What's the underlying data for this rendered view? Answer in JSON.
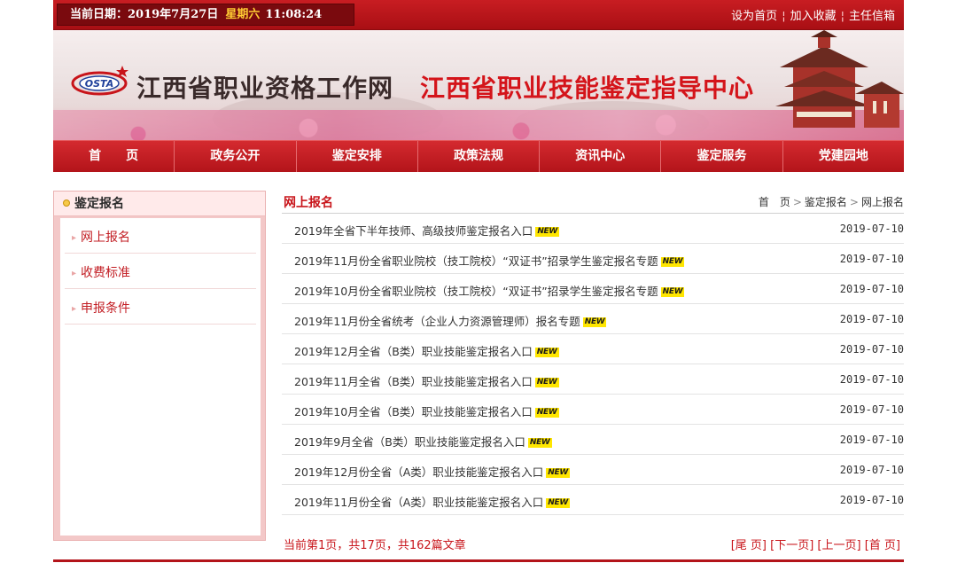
{
  "topbar": {
    "date_label": "当前日期：2019年7月27日",
    "weekday": "星期六",
    "time": "11:08:24",
    "links": [
      "设为首页",
      "加入收藏",
      "主任信箱"
    ]
  },
  "banner": {
    "logo_text": "OSTA",
    "title_left": "江西省职业资格工作网",
    "title_right": "江西省职业技能鉴定指导中心"
  },
  "nav": {
    "items": [
      "首　　页",
      "政务公开",
      "鉴定安排",
      "政策法规",
      "资讯中心",
      "鉴定服务",
      "党建园地"
    ]
  },
  "sidebar": {
    "heading": "鉴定报名",
    "items": [
      "网上报名",
      "收费标准",
      "申报条件"
    ]
  },
  "main": {
    "title": "网上报名",
    "breadcrumb": [
      "首　页",
      "鉴定报名",
      "网上报名"
    ],
    "new_badge": "NEW",
    "rows": [
      {
        "title": "2019年全省下半年技师、高级技师鉴定报名入口",
        "date": "2019-07-10"
      },
      {
        "title": "2019年11月份全省职业院校（技工院校）“双证书”招录学生鉴定报名专题",
        "date": "2019-07-10"
      },
      {
        "title": "2019年10月份全省职业院校（技工院校）“双证书”招录学生鉴定报名专题",
        "date": "2019-07-10"
      },
      {
        "title": "2019年11月份全省统考（企业人力资源管理师）报名专题",
        "date": "2019-07-10"
      },
      {
        "title": "2019年12月全省（B类）职业技能鉴定报名入口",
        "date": "2019-07-10"
      },
      {
        "title": "2019年11月全省（B类）职业技能鉴定报名入口",
        "date": "2019-07-10"
      },
      {
        "title": "2019年10月全省（B类）职业技能鉴定报名入口",
        "date": "2019-07-10"
      },
      {
        "title": "2019年9月全省（B类）职业技能鉴定报名入口",
        "date": "2019-07-10"
      },
      {
        "title": "2019年12月份全省（A类）职业技能鉴定报名入口",
        "date": "2019-07-10"
      },
      {
        "title": "2019年11月份全省（A类）职业技能鉴定报名入口",
        "date": "2019-07-10"
      }
    ],
    "pager_info": "当前第1页，共17页，共162篇文章",
    "pager_links": [
      "[尾 页]",
      "[下一页]",
      "[上一页]",
      "[首 页]"
    ]
  },
  "colors": {
    "brand_red": "#c8141a",
    "nav_red": "#b3141a",
    "sidebar_pink": "#f3c8c8",
    "new_badge_yellow": "#ffe600"
  }
}
